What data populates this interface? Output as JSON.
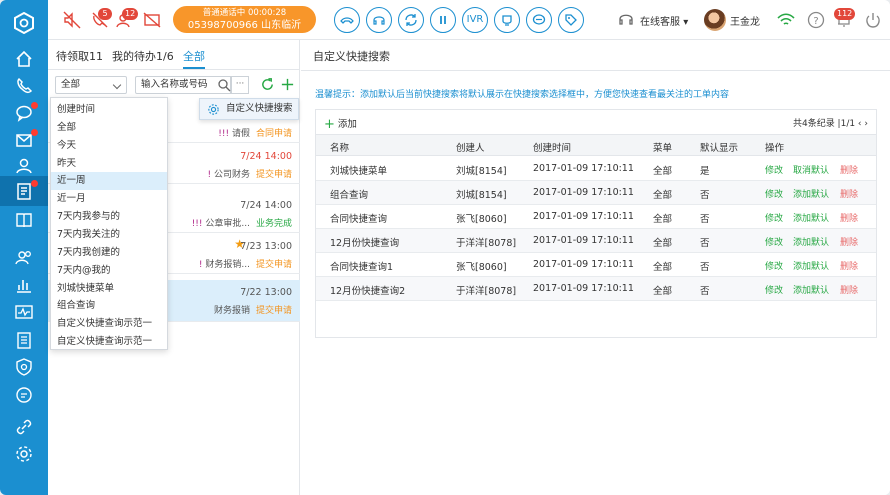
{
  "topbar": {
    "badges": {
      "missed": "5",
      "voicemail": "12",
      "notify": "112"
    },
    "call": {
      "status": "普通通话中  00:00:28",
      "number": "05398700966 山东临沂"
    },
    "buttons": [
      "IVR"
    ],
    "online_label": "在线客服",
    "agent_name": "王金龙"
  },
  "left": {
    "tabs": [
      "待领取11",
      "我的待办1/6",
      "全部"
    ],
    "filter_value": "全部",
    "search_placeholder": "输入名称或号码",
    "cards": [
      {
        "time": "",
        "info_bang": "!!!",
        "info_text": "请假",
        "status": "合同申请",
        "status_color": "orange"
      },
      {
        "time": "7/24 14:00",
        "info_bang": "!",
        "info_text": "公司财务",
        "status": "提交申请",
        "status_color": "orange"
      },
      {
        "time": "7/24 14:00",
        "info_bang": "!!!",
        "info_text": "公章审批...",
        "status": "业务完成",
        "status_color": "green"
      },
      {
        "time": "7/23 13:00",
        "info_bang": "!",
        "info_text": "财务报销...",
        "status": "提交申请",
        "status_color": "orange"
      },
      {
        "time": "7/22 13:00",
        "info_bang": "",
        "info_text": "财务报销",
        "status": "提交申请",
        "status_color": "orange"
      }
    ],
    "dropdown": [
      "创建时间",
      "全部",
      "今天",
      "昨天",
      "近一周",
      "近一月",
      "7天内我参与的",
      "7天内我关注的",
      "7天内我创建的",
      "7天内@我的",
      "刘城快捷菜单",
      "组合查询",
      "自定义快捷查询示范一",
      "自定义快捷查询示范一"
    ],
    "dropdown_selected_index": 4,
    "quick_popup": "自定义快捷搜索"
  },
  "right": {
    "title": "自定义快捷搜索",
    "hint": "温馨提示：添加默认后当前快捷搜索将默认展示在快捷搜索选择框中，方便您快速查看最关注的工单内容",
    "add_label": "添加",
    "pager": "共4条纪录 |1/1  ‹  ›",
    "columns": [
      "名称",
      "创建人",
      "创建时间",
      "菜单",
      "默认显示",
      "操作"
    ],
    "rows": [
      {
        "name": "刘城快捷菜单",
        "creator": "刘城[8154]",
        "created": "2017-01-09  17:10:11",
        "menu": "全部",
        "default": "是",
        "ops": [
          "修改",
          "取消默认",
          "删除"
        ]
      },
      {
        "name": "组合查询",
        "creator": "刘城[8154]",
        "created": "2017-01-09  17:10:11",
        "menu": "全部",
        "default": "否",
        "ops": [
          "修改",
          "添加默认",
          "删除"
        ]
      },
      {
        "name": "合同快捷查询",
        "creator": "张飞[8060]",
        "created": "2017-01-09  17:10:11",
        "menu": "全部",
        "default": "否",
        "ops": [
          "修改",
          "添加默认",
          "删除"
        ]
      },
      {
        "name": "12月份快捷查询",
        "creator": "于洋洋[8078]",
        "created": "2017-01-09  17:10:11",
        "menu": "全部",
        "default": "否",
        "ops": [
          "修改",
          "添加默认",
          "删除"
        ]
      },
      {
        "name": "合同快捷查询1",
        "creator": "张飞[8060]",
        "created": "2017-01-09  17:10:11",
        "menu": "全部",
        "default": "否",
        "ops": [
          "修改",
          "添加默认",
          "删除"
        ]
      },
      {
        "name": "12月份快捷查询2",
        "creator": "于洋洋[8078]",
        "created": "2017-01-09  17:10:11",
        "menu": "全部",
        "default": "否",
        "ops": [
          "修改",
          "添加默认",
          "删除"
        ]
      }
    ]
  },
  "colors": {
    "brand": "#1b8fd0",
    "accent_orange": "#f8962a",
    "success": "#27a844",
    "danger": "#e86a6a"
  }
}
